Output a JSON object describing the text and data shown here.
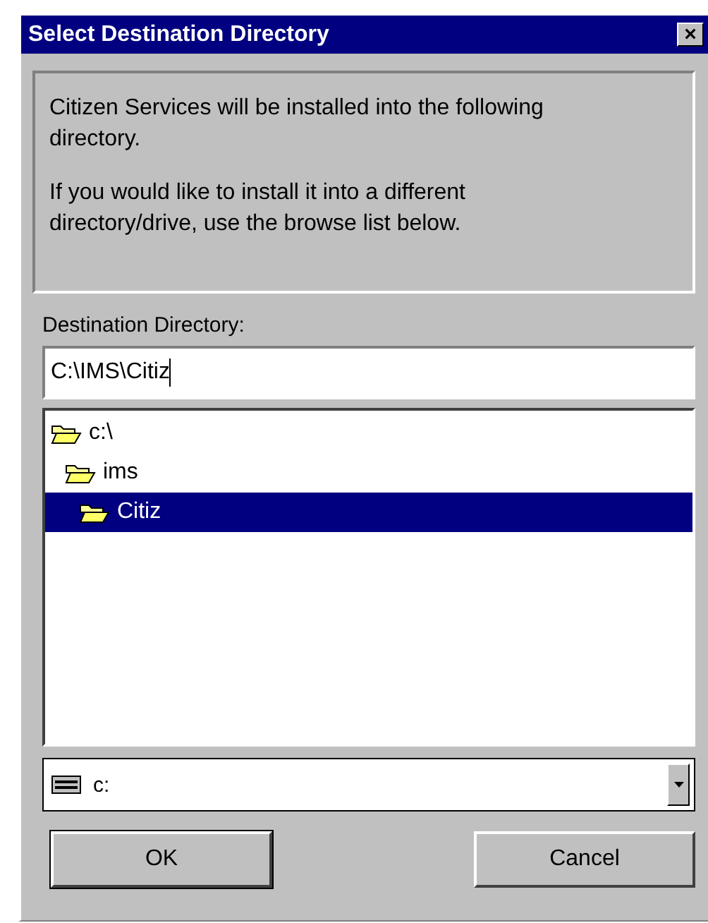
{
  "window": {
    "title": "Select Destination Directory",
    "close": "×"
  },
  "message": [
    "Citizen Services will be installed into the following directory.",
    "If you would like to install it into a different directory/drive, use the browse list below."
  ],
  "destination": {
    "label": "Destination Directory:",
    "value": "C:\\IMS\\Citiz"
  },
  "tree": [
    {
      "label": "c:\\",
      "selected": false,
      "children": [
        {
          "label": "ims",
          "selected": false,
          "children": [
            {
              "label": "Citiz",
              "selected": true
            }
          ]
        }
      ]
    }
  ],
  "drive": {
    "value": "c:"
  },
  "buttons": [
    {
      "label": "OK",
      "default": true
    },
    {
      "label": "Cancel",
      "default": false
    }
  ]
}
